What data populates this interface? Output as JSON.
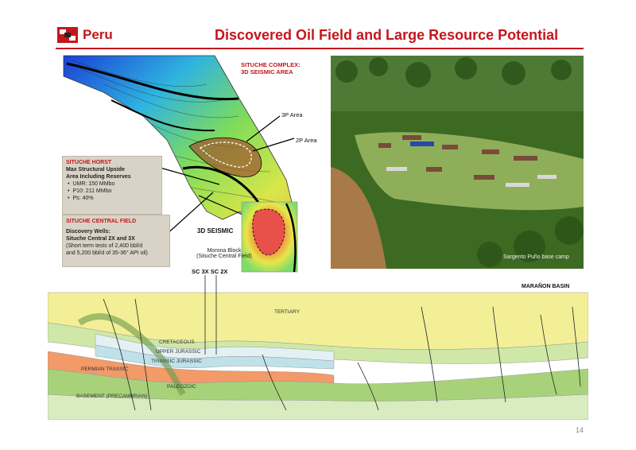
{
  "header": {
    "brand": "Peru",
    "title": "Discovered Oil Field and Large Resource Potential",
    "accent_color": "#c4161c"
  },
  "map": {
    "complex_label_line1": "SITUCHE COMPLEX:",
    "complex_label_line2": "3D SEISMIC AREA",
    "label_3p": "3P Area",
    "label_2p": "2P Area",
    "seismic_inset_label": "3D SEISMIC",
    "block_line1": "Morona Block",
    "block_line2": "(Situche Central Field)",
    "wells_label": "SC 3X SC 2X"
  },
  "horst_box": {
    "heading": "SITUCHE HORST",
    "subtitle_line1": "Max Structural Upside",
    "subtitle_line2": "Area Including Reserves",
    "bullets": [
      "UMR: 150 MMbo",
      "P10: 211 MMbo",
      "Ps: 40%"
    ]
  },
  "central_box": {
    "heading": "SITUCHE CENTRAL FIELD",
    "wells_title": "Discovery Wells:",
    "wells_names": "Situche Central 2X and 3X",
    "tests_line1": "(Short term tests of 2,400 bbl/d",
    "tests_line2": "and 5,200 bbl/d of 35-36° API oil)"
  },
  "photo": {
    "caption": "Sargento Puño base camp"
  },
  "section": {
    "basin": "MARAÑON BASIN",
    "layers": {
      "tertiary": "TERTIARY",
      "cretaceous": "CRETACEOUS",
      "upper_jurassic": "UPPER JURASSIC",
      "triassic_jurassic": "TRIASSIC JURASSIC",
      "permian_trassic": "PERMIAN TRASSIC",
      "paleozoic": "PALEOZOIC",
      "basement": "BASEMENT (PRECAMBRIAN)"
    }
  },
  "page_number": "14"
}
